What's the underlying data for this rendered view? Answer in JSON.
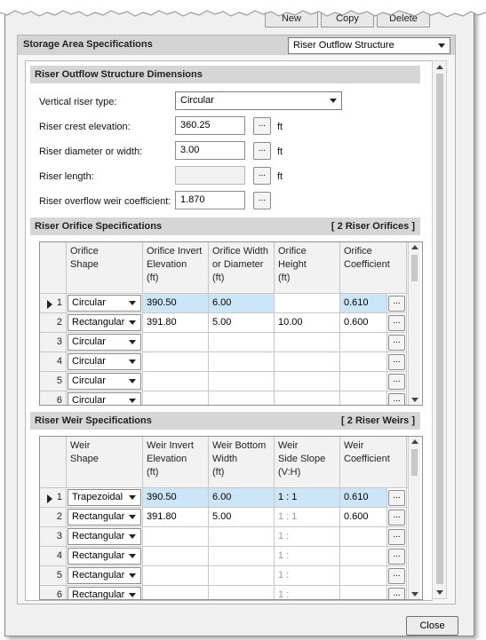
{
  "window": {
    "top_buttons": [
      "New",
      "Copy",
      "Delete"
    ],
    "close_label": "Close"
  },
  "header": {
    "title": "Storage Area Specifications",
    "view_select": "Riser Outflow Structure"
  },
  "dimensions": {
    "title": "Riser Outflow Structure Dimensions",
    "riser_type_label": "Vertical riser type:",
    "riser_type_value": "Circular",
    "crest_label": "Riser crest elevation:",
    "crest_value": "360.25",
    "diameter_label": "Riser diameter or width:",
    "diameter_value": "3.00",
    "length_label": "Riser length:",
    "length_value": "",
    "weir_coef_label": "Riser overflow weir coefficient:",
    "weir_coef_value": "1.870",
    "unit": "ft",
    "ellipsis": "..."
  },
  "orifice": {
    "title": "Riser Orifice Specifications",
    "count": "[ 2 Riser Orifices ]",
    "headers": [
      "Orifice\nShape",
      "Orifice Invert\nElevation\n(ft)",
      "Orifice Width\nor Diameter\n(ft)",
      "Orifice\nHeight\n(ft)",
      "Orifice\nCoefficient"
    ],
    "rows": [
      {
        "n": "1",
        "shape": "Circular",
        "c1": "390.50",
        "c2": "6.00",
        "c3": "",
        "c4": "0.610"
      },
      {
        "n": "2",
        "shape": "Rectangular",
        "c1": "391.80",
        "c2": "5.00",
        "c3": "10.00",
        "c4": "0.600"
      },
      {
        "n": "3",
        "shape": "Circular",
        "c1": "",
        "c2": "",
        "c3": "",
        "c4": ""
      },
      {
        "n": "4",
        "shape": "Circular",
        "c1": "",
        "c2": "",
        "c3": "",
        "c4": ""
      },
      {
        "n": "5",
        "shape": "Circular",
        "c1": "",
        "c2": "",
        "c3": "",
        "c4": ""
      },
      {
        "n": "6",
        "shape": "Circular",
        "c1": "",
        "c2": "",
        "c3": "",
        "c4": ""
      }
    ]
  },
  "weir": {
    "title": "Riser Weir Specifications",
    "count": "[ 2 Riser Weirs ]",
    "headers": [
      "Weir\nShape",
      "Weir Invert\nElevation\n(ft)",
      "Weir Bottom\nWidth\n(ft)",
      "Weir\nSide Slope\n(V:H)",
      "Weir\nCoefficient"
    ],
    "rows": [
      {
        "n": "1",
        "shape": "Trapezoidal",
        "c1": "390.50",
        "c2": "6.00",
        "c3": "1 : 1",
        "c4": "0.610"
      },
      {
        "n": "2",
        "shape": "Rectangular",
        "c1": "391.80",
        "c2": "5.00",
        "c3": "1 : 1",
        "c4": "0.600"
      },
      {
        "n": "3",
        "shape": "Rectangular",
        "c1": "",
        "c2": "",
        "c3": "1 :",
        "c4": ""
      },
      {
        "n": "4",
        "shape": "Rectangular",
        "c1": "",
        "c2": "",
        "c3": "1 :",
        "c4": ""
      },
      {
        "n": "5",
        "shape": "Rectangular",
        "c1": "",
        "c2": "",
        "c3": "1 :",
        "c4": ""
      },
      {
        "n": "6",
        "shape": "Rectangular",
        "c1": "",
        "c2": "",
        "c3": "1 :",
        "c4": ""
      }
    ]
  }
}
